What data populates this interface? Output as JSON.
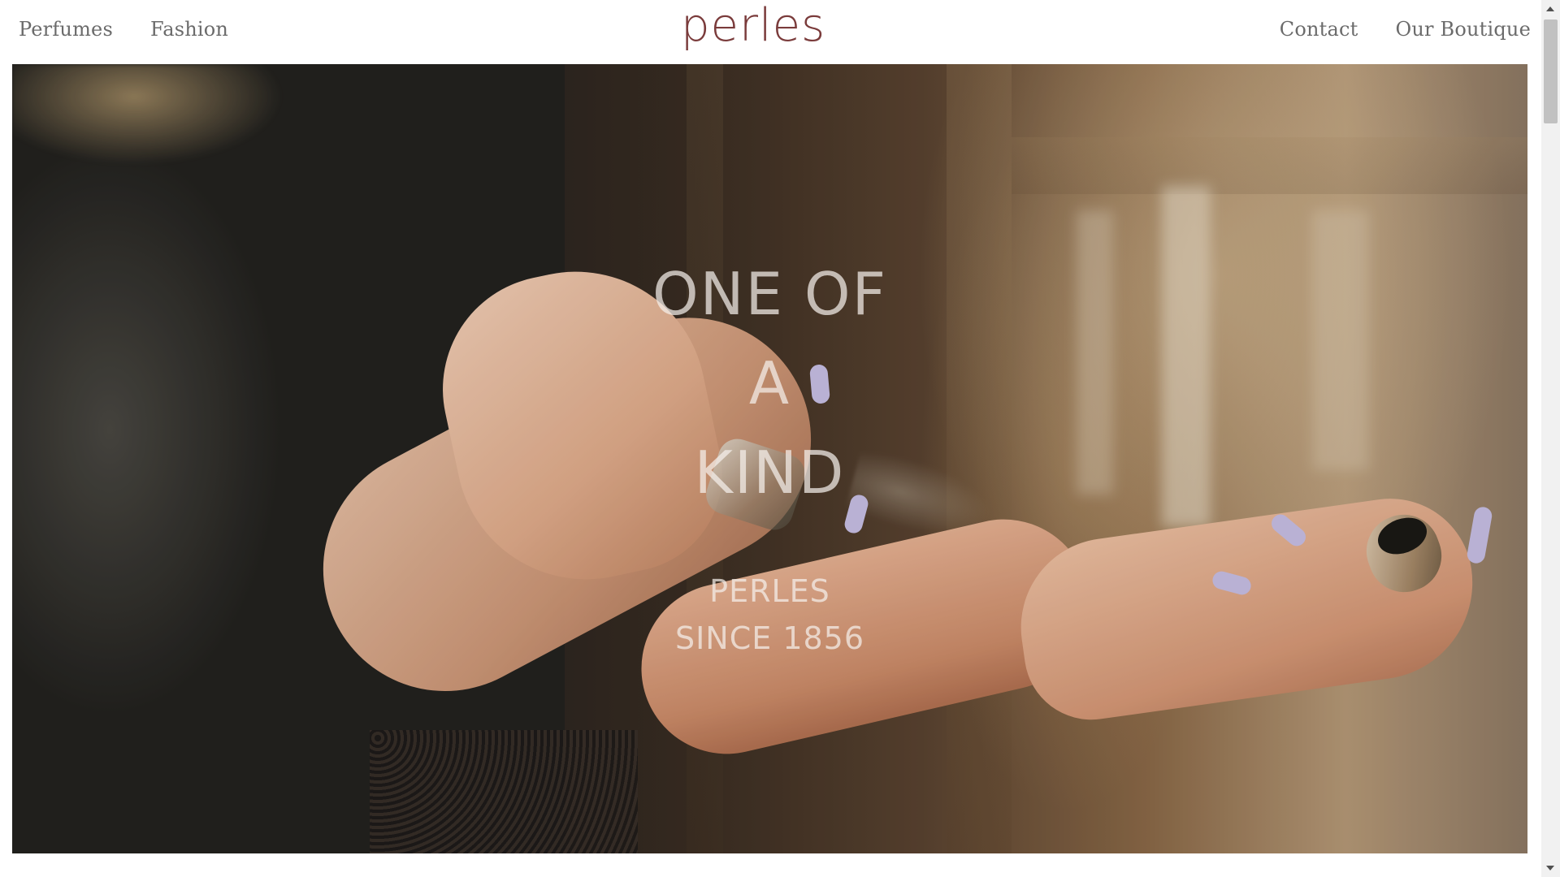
{
  "header": {
    "logo_text": "perles",
    "nav_left": [
      {
        "label": "Perfumes"
      },
      {
        "label": "Fashion"
      }
    ],
    "nav_right": [
      {
        "label": "Contact"
      },
      {
        "label": "Our Boutique"
      }
    ]
  },
  "hero": {
    "headline_lines": [
      "ONE OF",
      "A",
      "KIND"
    ],
    "subline_lines": [
      "PERLES",
      "SINCE 1856"
    ]
  },
  "colors": {
    "logo": "#7a3b3b",
    "nav_text": "#6b6b6b",
    "hero_text": "#f5f0eb",
    "background": "#ffffff",
    "scrollbar_track": "#f1f1f1",
    "scrollbar_thumb": "#c1c1c1"
  }
}
